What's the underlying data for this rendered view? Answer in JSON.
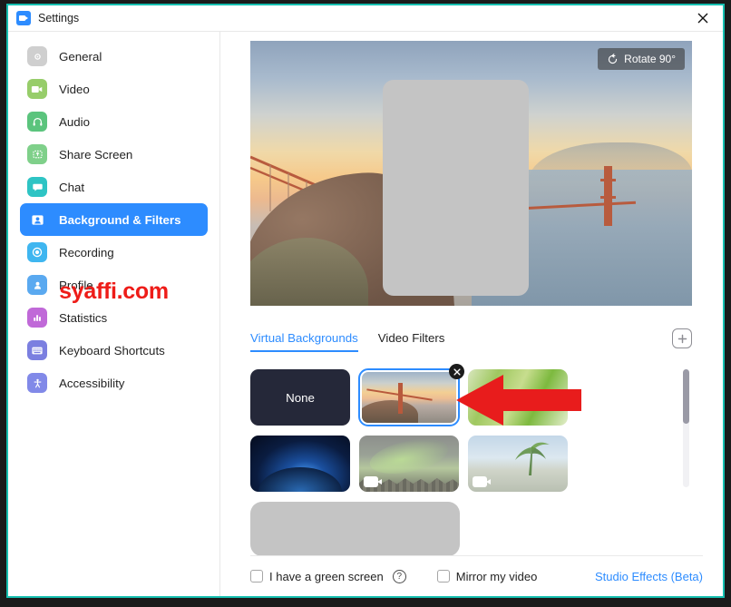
{
  "window": {
    "title": "Settings",
    "logo_icon": "zoom-logo-icon",
    "close_icon": "close-icon",
    "border_color": "#16bfb0"
  },
  "sidebar": {
    "items": [
      {
        "label": "General",
        "icon": "gear-icon",
        "color": "#cfcfcf",
        "active": false
      },
      {
        "label": "Video",
        "icon": "video-camera-icon",
        "color": "#97cd6a",
        "active": false
      },
      {
        "label": "Audio",
        "icon": "headphones-icon",
        "color": "#5bc47d",
        "active": false
      },
      {
        "label": "Share Screen",
        "icon": "share-screen-icon",
        "color": "#7fd08a",
        "active": false
      },
      {
        "label": "Chat",
        "icon": "chat-bubble-icon",
        "color": "#2ec4c4",
        "active": false
      },
      {
        "label": "Background & Filters",
        "icon": "background-person-icon",
        "color": "#2d8cff",
        "active": true
      },
      {
        "label": "Recording",
        "icon": "record-circle-icon",
        "color": "#3fb6f0",
        "active": false
      },
      {
        "label": "Profile",
        "icon": "person-icon",
        "color": "#5aa9f0",
        "active": false
      },
      {
        "label": "Statistics",
        "icon": "bar-chart-icon",
        "color": "#c069d8",
        "active": false
      },
      {
        "label": "Keyboard Shortcuts",
        "icon": "keyboard-icon",
        "color": "#7b7fe0",
        "active": false
      },
      {
        "label": "Accessibility",
        "icon": "accessibility-icon",
        "color": "#8189e8",
        "active": false
      }
    ],
    "watermark": "syaffi.com",
    "watermark_color": "#ee1c18"
  },
  "preview": {
    "rotate_button": "Rotate 90°",
    "rotate_icon": "rotate-counterclockwise-icon",
    "privacy_mask_color": "#c4c4c4"
  },
  "tabs": [
    {
      "label": "Virtual Backgrounds",
      "active": true
    },
    {
      "label": "Video Filters",
      "active": false
    }
  ],
  "add_button_icon": "plus-box-icon",
  "thumbnails": [
    {
      "name": "None",
      "label": "None",
      "kind": "none",
      "selected": false,
      "video": false,
      "removable": false
    },
    {
      "name": "Golden Gate Bridge",
      "label": "",
      "kind": "golden-gate",
      "selected": true,
      "video": false,
      "removable": true
    },
    {
      "name": "Grass",
      "label": "",
      "kind": "grass",
      "selected": false,
      "video": false,
      "removable": false
    },
    {
      "name": "Earth from Space",
      "label": "",
      "kind": "space",
      "selected": false,
      "video": false,
      "removable": false
    },
    {
      "name": "Aurora Forest",
      "label": "",
      "kind": "aurora",
      "selected": false,
      "video": true,
      "removable": false
    },
    {
      "name": "Beach Palm",
      "label": "",
      "kind": "beach",
      "selected": false,
      "video": true,
      "removable": false
    }
  ],
  "placeholder_block": {
    "color": "#c4c4c4"
  },
  "annotation": {
    "shape": "red-left-arrow",
    "color": "#e81c1c"
  },
  "scrollbar": {
    "track_color": "#f1f1f4",
    "thumb_color": "#9a9aa6"
  },
  "bottom": {
    "green_screen_label": "I have a green screen",
    "green_screen_checked": false,
    "help_icon": "help-circle-icon",
    "help_glyph": "?",
    "mirror_label": "Mirror my video",
    "mirror_checked": false,
    "studio_effects_label": "Studio Effects (Beta)",
    "link_color": "#2d8cff"
  }
}
